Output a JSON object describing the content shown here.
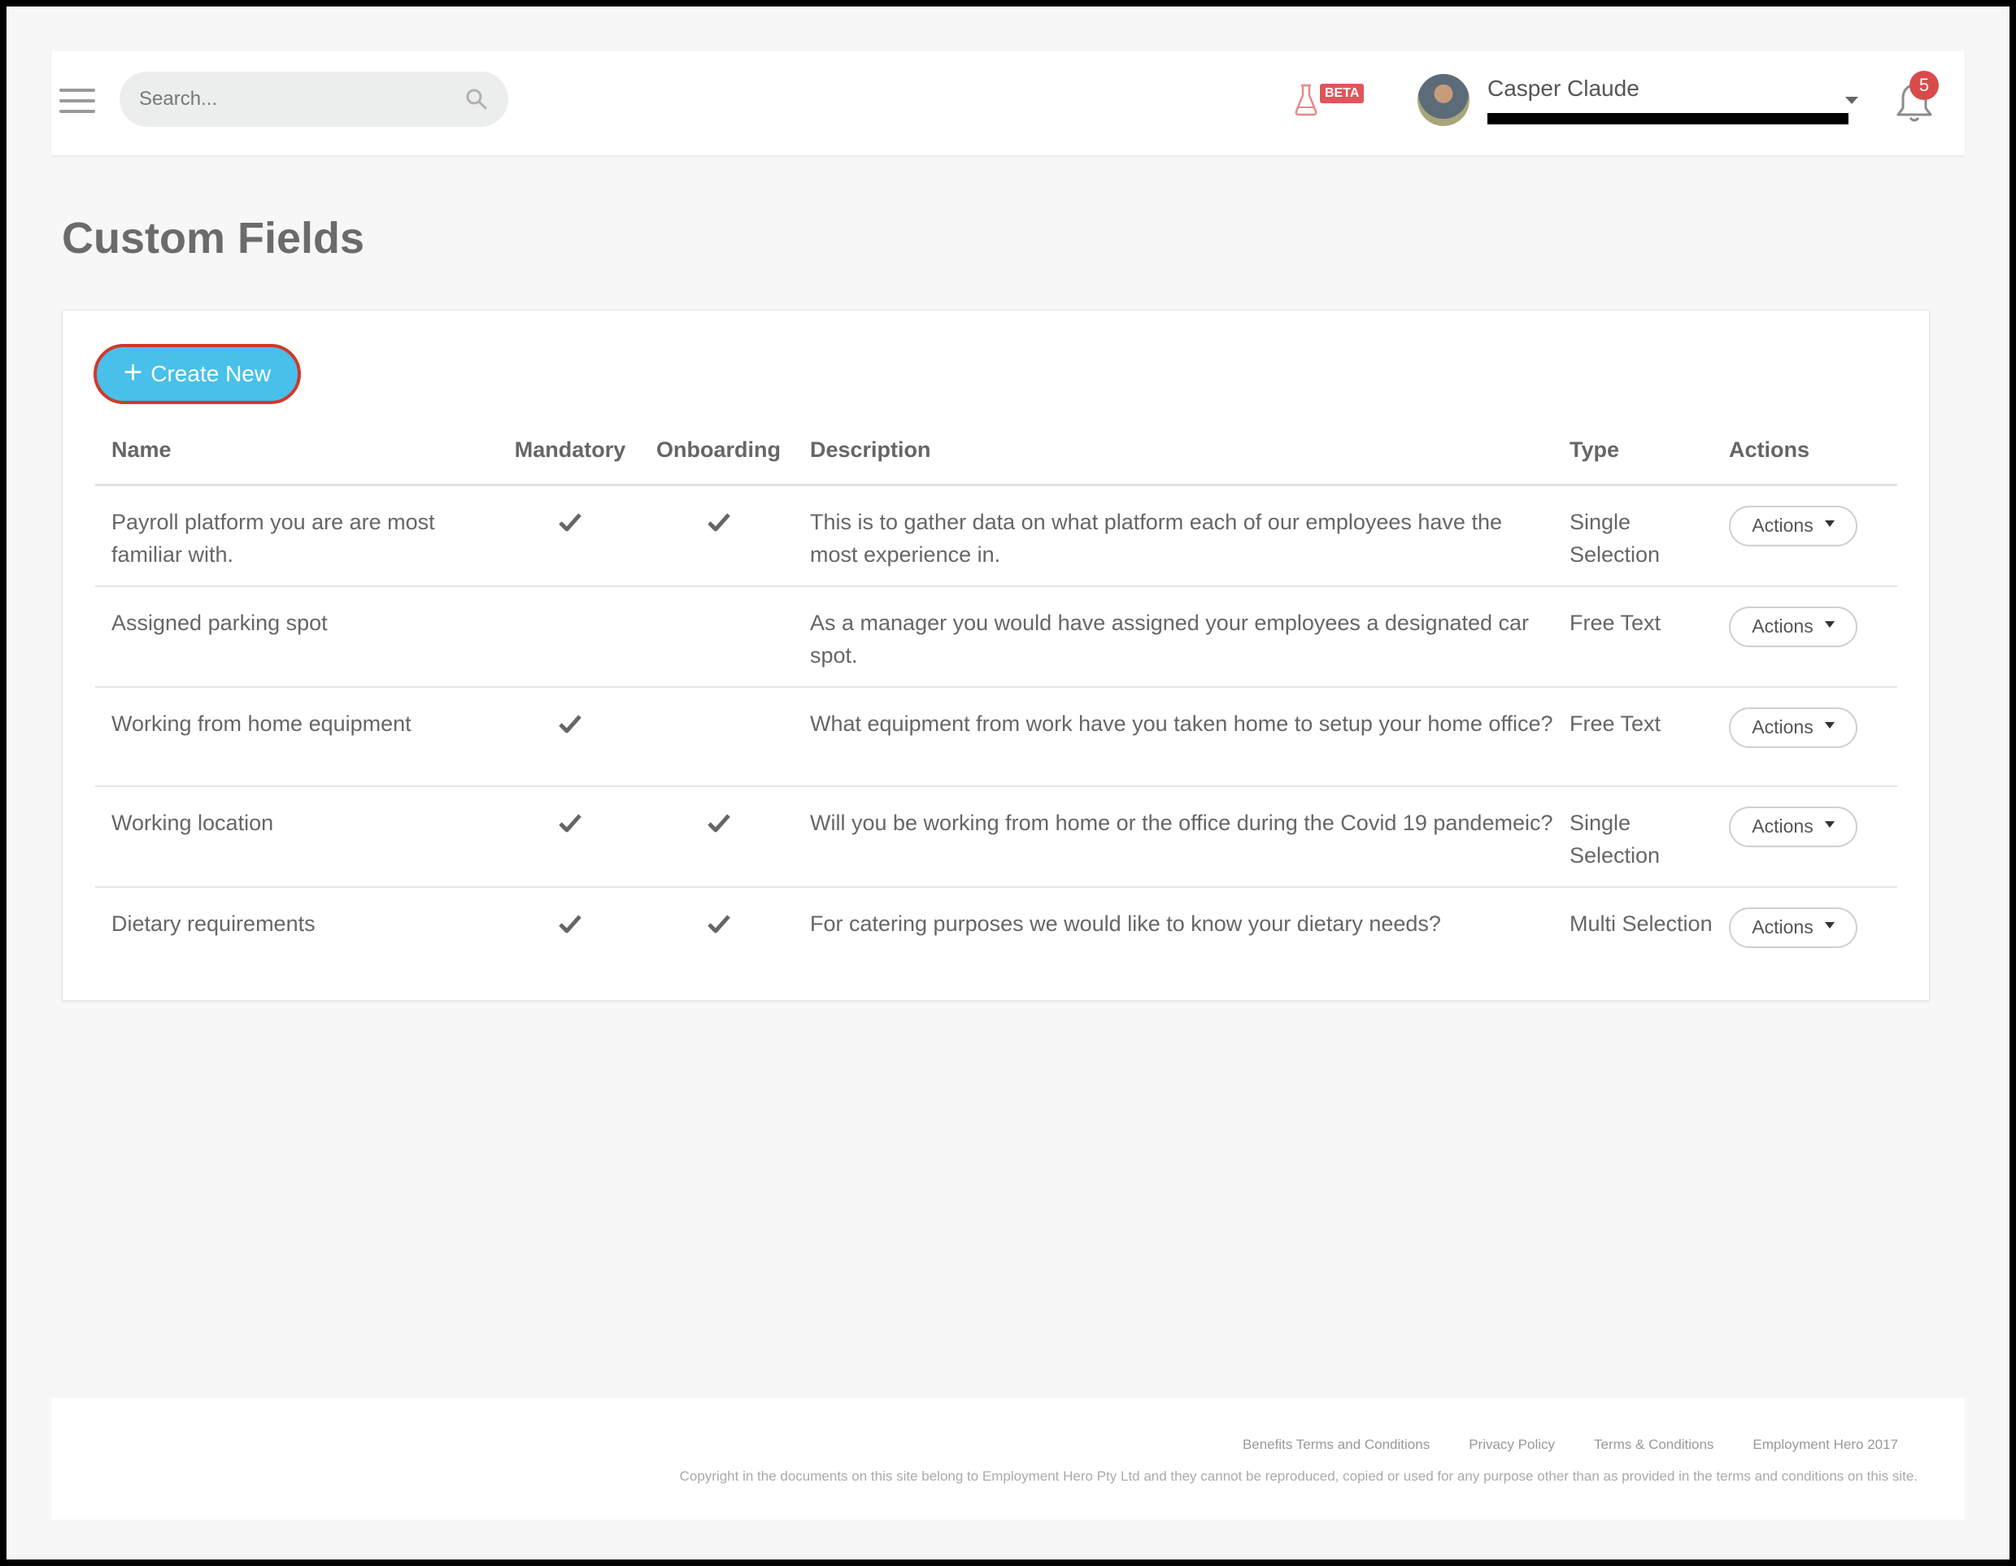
{
  "header": {
    "search_placeholder": "Search...",
    "beta_label": "BETA",
    "user_name": "Casper Claude",
    "notification_count": "5"
  },
  "page": {
    "title": "Custom Fields"
  },
  "toolbar": {
    "create_label": "Create New"
  },
  "table": {
    "columns": {
      "name": "Name",
      "mandatory": "Mandatory",
      "onboarding": "Onboarding",
      "description": "Description",
      "type": "Type",
      "actions": "Actions"
    },
    "rows": [
      {
        "name": "Payroll platform you are are most familiar with.",
        "mandatory": true,
        "onboarding": true,
        "description": "This is to gather data on what platform each of our employees have the most experience in.",
        "type": "Single Selection",
        "action_label": "Actions"
      },
      {
        "name": "Assigned parking spot",
        "mandatory": false,
        "onboarding": false,
        "description": "As a manager you would have assigned your employees a designated car spot.",
        "type": "Free Text",
        "action_label": "Actions"
      },
      {
        "name": "Working from home equipment",
        "mandatory": true,
        "onboarding": false,
        "description": "What equipment from work have you taken home to setup your home office?",
        "type": "Free Text",
        "action_label": "Actions"
      },
      {
        "name": "Working location",
        "mandatory": true,
        "onboarding": true,
        "description": "Will you be working from home or the office during the Covid 19 pandemeic?",
        "type": "Single Selection",
        "action_label": "Actions"
      },
      {
        "name": "Dietary requirements",
        "mandatory": true,
        "onboarding": true,
        "description": "For catering purposes we would like to know your dietary needs?",
        "type": "Multi Selection",
        "action_label": "Actions"
      }
    ]
  },
  "footer": {
    "links": [
      "Benefits Terms and Conditions",
      "Privacy Policy",
      "Terms & Conditions",
      "Employment Hero 2017"
    ],
    "copyright": "Copyright in the documents on this site belong to Employment Hero Pty Ltd and they cannot be reproduced, copied or used for any purpose other than as provided in the terms and conditions on this site."
  },
  "colors": {
    "accent": "#48c0ea",
    "highlight_border": "#d0392b",
    "badge": "#d94b4b"
  },
  "icons": {
    "menu": "hamburger-icon",
    "search": "search-icon",
    "beta": "flask-icon",
    "caret": "chevron-down-icon",
    "notifications": "bell-icon",
    "check": "check-icon",
    "plus": "plus-icon"
  }
}
